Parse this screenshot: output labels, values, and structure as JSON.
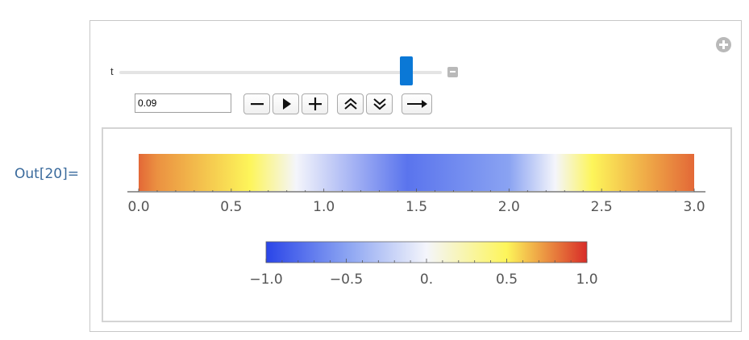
{
  "cell_label": "Out[20]=",
  "controls": {
    "variable_label": "t",
    "input_value": "0.09",
    "slider_fraction": 0.89
  },
  "icons": {
    "add": "plus-circle-icon",
    "collapse": "minus-square-icon",
    "decrement": "minus-icon",
    "play": "play-icon",
    "increment": "plus-icon",
    "faster": "double-chevron-up-icon",
    "slower": "double-chevron-down-icon",
    "direction": "arrow-right-icon"
  },
  "chart_data": [
    {
      "type": "heatmap",
      "title": "",
      "xlabel": "",
      "ylabel": "",
      "x_range": [
        0,
        3
      ],
      "tick_labels": [
        "0.0",
        "0.5",
        "1.0",
        "1.5",
        "2.0",
        "2.5",
        "3.0"
      ],
      "tick_values": [
        0,
        0.5,
        1,
        1.5,
        2,
        2.5,
        3
      ],
      "gradient_stops": [
        {
          "x": 0.0,
          "value": 0.85
        },
        {
          "x": 0.1,
          "value": 0.75
        },
        {
          "x": 0.6,
          "value": 0.5
        },
        {
          "x": 0.85,
          "value": 0.0
        },
        {
          "x": 1.45,
          "value": -0.75
        },
        {
          "x": 2.0,
          "value": -0.5
        },
        {
          "x": 2.25,
          "value": 0.0
        },
        {
          "x": 2.45,
          "value": 0.5
        },
        {
          "x": 3.0,
          "value": 0.85
        }
      ]
    },
    {
      "type": "heatmap",
      "title": "",
      "legend": "color-bar",
      "value_range": [
        -1,
        1
      ],
      "tick_labels": [
        "−1.0",
        "−0.5",
        "0.",
        "0.5",
        "1.0"
      ],
      "tick_values": [
        -1,
        -0.5,
        0,
        0.5,
        1
      ],
      "colors": {
        "-1": "#2a45e8",
        "-0.5": "#8aa3f2",
        "0": "#f4f5fb",
        "0.5": "#fdf55a",
        "1": "#d82c28"
      }
    }
  ]
}
